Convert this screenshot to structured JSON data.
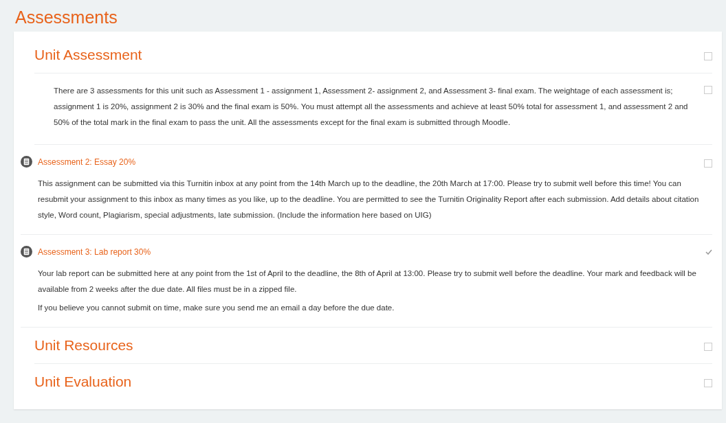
{
  "page_title": "Assessments",
  "items": [
    {
      "kind": "heading",
      "label": "Unit Assessment",
      "completed": false
    },
    {
      "kind": "text",
      "paragraphs": [
        "There are 3 assessments for this unit such as Assessment 1 - assignment 1, Assessment 2- assignment 2, and Assessment 3- final exam.  The weightage of each assessment is; assignment 1 is 20%, assignment 2  is 30% and the final exam is 50%. You must attempt all the assessments and achieve at least 50% total for assessment 1, and assessment 2 and 50% of the total mark in the final exam to pass the unit.  All the assessments except for the final exam is submitted through Moodle."
      ],
      "completed": false
    },
    {
      "kind": "activity",
      "title": "Assessment 2: Essay 20%",
      "paragraphs": [
        "This assignment can be submitted via this Turnitin inbox at any point from the 14th March up to the deadline, the 20th March at 17:00. Please try to submit well before this time! You can resubmit your assignment to this inbox as many times as you like, up to the deadline. You are permitted to see the Turnitin Originality Report after each submission. Add details about citation style, Word count, Plagiarism, special adjustments, late submission. (Include the information here based on UIG)"
      ],
      "completed": false
    },
    {
      "kind": "activity",
      "title": "Assessment 3: Lab report 30%",
      "paragraphs": [
        "Your lab report can be submitted here at any point from the 1st of April to the deadline, the 8th of April at  13:00. Please try to submit well before the deadline. Your mark and feedback will be available from 2 weeks after the due date. All files must be in a zipped file.",
        "If you believe you cannot submit on time, make sure you send me an email a day before the due date."
      ],
      "completed": true
    },
    {
      "kind": "heading",
      "label": "Unit Resources",
      "completed": false
    },
    {
      "kind": "heading",
      "label": "Unit Evaluation",
      "completed": false
    }
  ]
}
